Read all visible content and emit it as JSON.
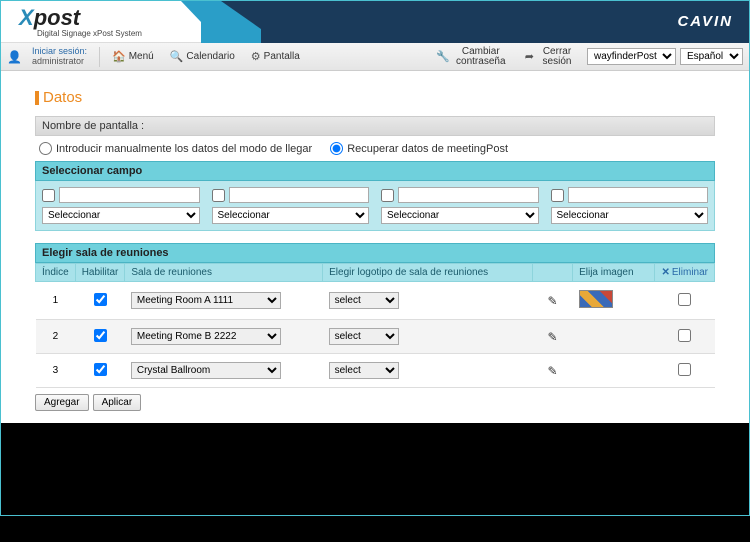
{
  "brand": {
    "name_x": "X",
    "name_post": "post",
    "tagline": "Digital Signage xPost System",
    "company": "CAVIN"
  },
  "session": {
    "label": "Iniciar sesión:",
    "user": "administrator"
  },
  "toolbar": {
    "menu": "Menú",
    "calendar": "Calendario",
    "screen": "Pantalla",
    "change_pw": "Cambiar contraseña",
    "logout": "Cerrar sesión",
    "module_select": "wayfinderPost",
    "lang_select": "Español"
  },
  "page": {
    "title": "Datos",
    "screen_name_label": "Nombre de pantalla :",
    "radio_manual": "Introducir manualmente los datos del modo de llegar",
    "radio_retrieve": "Recuperar datos de meetingPost"
  },
  "select_field": {
    "heading": "Seleccionar campo",
    "placeholder": "Seleccionar"
  },
  "rooms": {
    "heading": "Elegir sala de reuniones",
    "cols": {
      "index": "Índice",
      "enable": "Habilitar",
      "room": "Sala de reuniones",
      "logo": "Elegir logotipo de sala de reuniones",
      "image": "Elija imagen",
      "delete": "Eliminar"
    },
    "logo_placeholder": "select",
    "rows": [
      {
        "idx": "1",
        "room": "Meeting Room A 1111",
        "has_thumb": true
      },
      {
        "idx": "2",
        "room": "Meeting Rome B 2222",
        "has_thumb": false
      },
      {
        "idx": "3",
        "room": "Crystal Ballroom",
        "has_thumb": false
      }
    ]
  },
  "buttons": {
    "add": "Agregar",
    "apply": "Aplicar"
  }
}
